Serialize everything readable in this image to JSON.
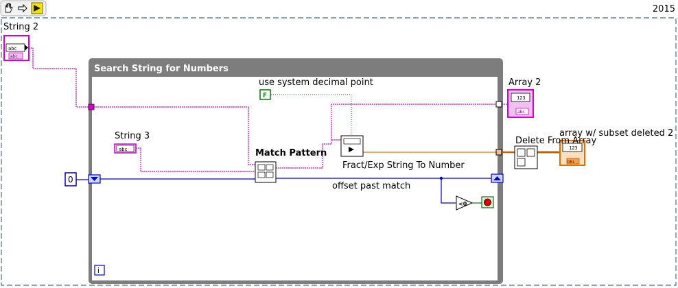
{
  "version": "2015",
  "toolbar": {
    "icons": [
      "hand-icon",
      "arrow-right-icon",
      "run-arrow-icon"
    ]
  },
  "controls": {
    "string2": {
      "label": "String 2",
      "glyph": "abc",
      "sub": "abc"
    },
    "string3": {
      "label": "String 3",
      "glyph": "abc"
    },
    "array2": {
      "label": "Array 2",
      "glyph": "123",
      "sub": "abc"
    },
    "array_subset": {
      "label": "array w/ subset deleted 2",
      "glyph": "123",
      "sub": "DBL"
    },
    "const_zero": {
      "value": "0"
    },
    "use_sys_decimal": {
      "label": "use system decimal point",
      "value": "F"
    }
  },
  "loop": {
    "title": "Search String for Numbers",
    "iteration_terminal": "i"
  },
  "functions": {
    "match_pattern": "Match Pattern",
    "fract_exp": "Fract/Exp String To Number",
    "delete_from_array": "Delete From Array",
    "offset_label": "offset past match",
    "less_than_zero": "<0"
  },
  "colors": {
    "string_wire": "#d200d2",
    "numeric_wire": "#0000cc",
    "boolean_wire": "#007a00",
    "dbl_wire": "#e07000",
    "loop_frame": "#808080",
    "stop": "#dd0000"
  }
}
